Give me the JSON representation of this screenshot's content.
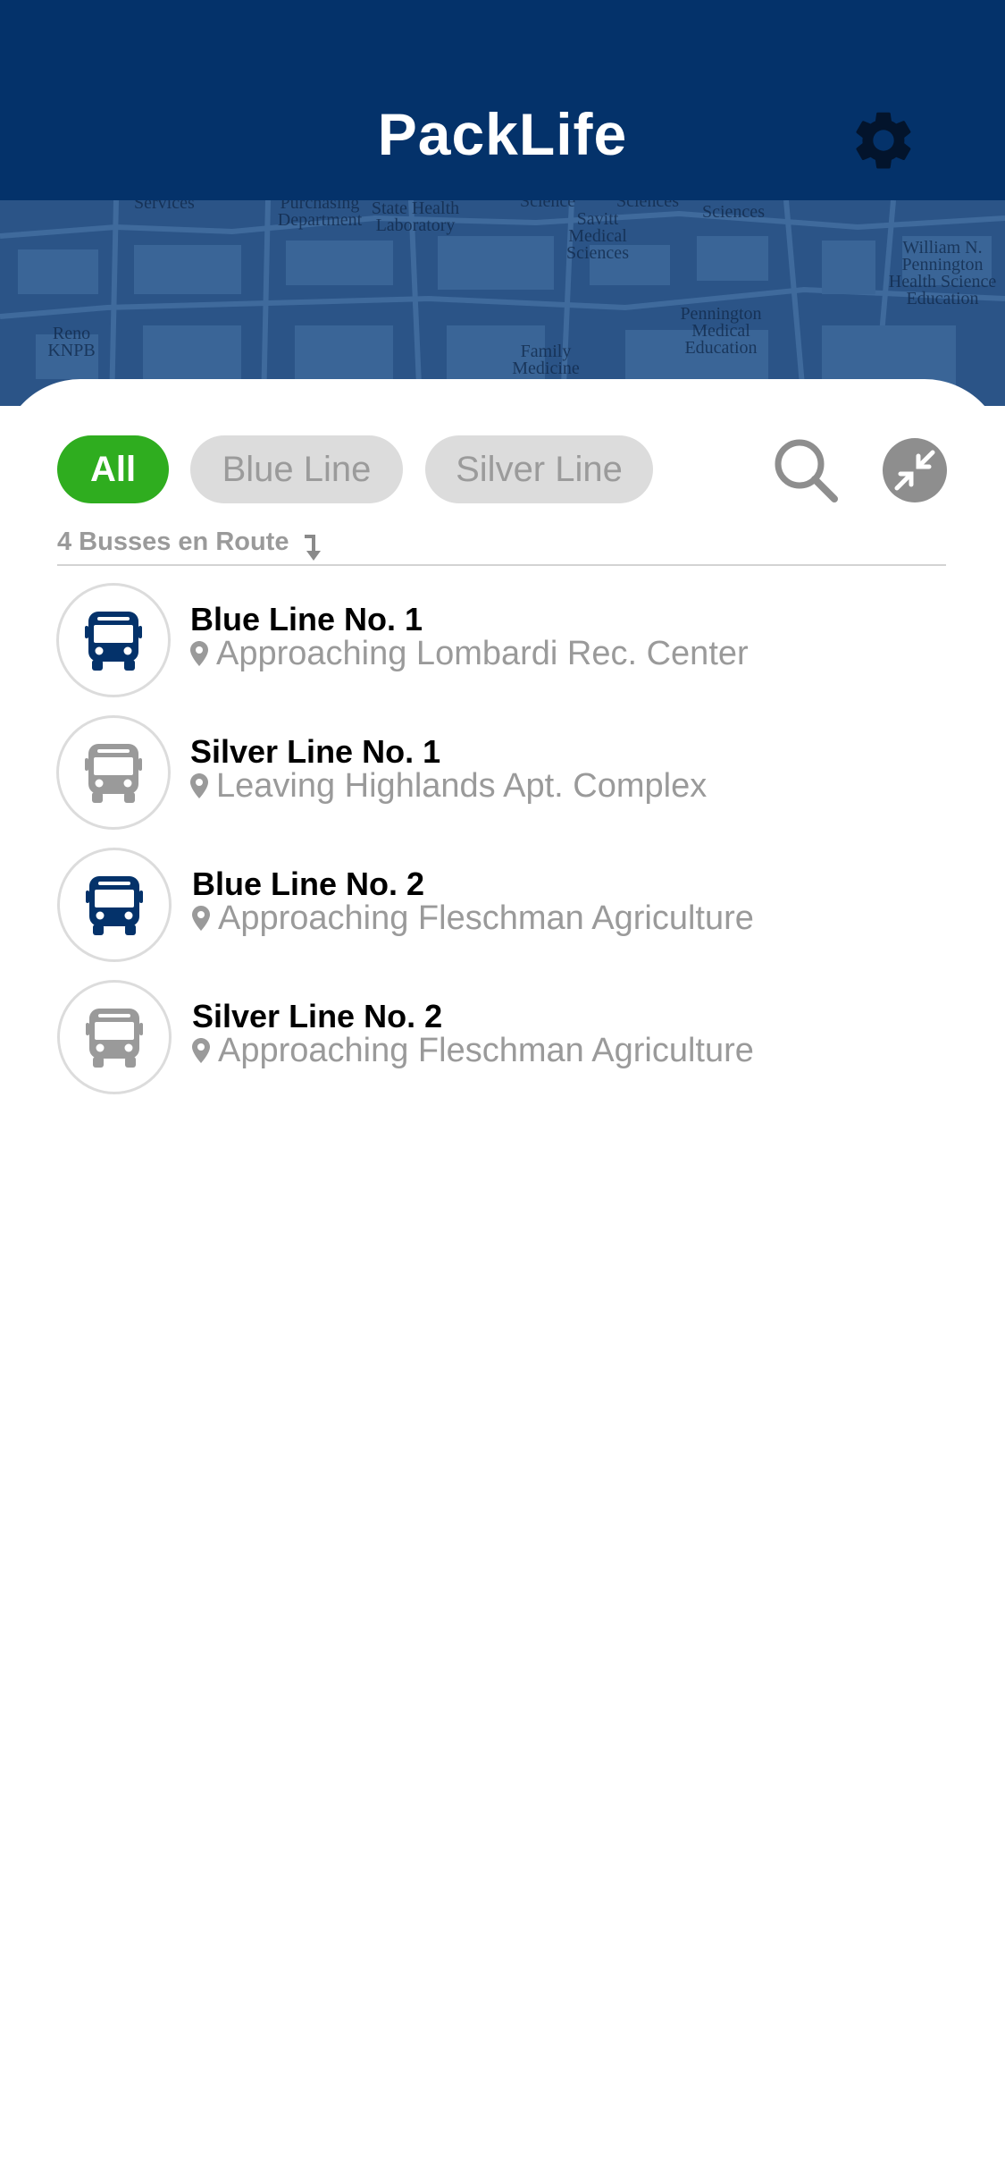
{
  "header": {
    "title": "PackLife",
    "settings_icon": "gear-icon"
  },
  "map": {
    "labels": [
      "Services",
      "Purchasing Department",
      "State Health Laboratory",
      "Science",
      "Savitt Medical Sciences",
      "Sciences",
      "Sciences",
      "William N. Pennington Health Science Education",
      "Pennington Medical Education",
      "Family Medicine",
      "Reno KNPB"
    ]
  },
  "filters": {
    "chips": [
      {
        "label": "All",
        "active": true
      },
      {
        "label": "Blue Line",
        "active": false
      },
      {
        "label": "Silver Line",
        "active": false
      }
    ],
    "search_icon": "search-icon",
    "collapse_icon": "collapse-icon"
  },
  "summary": {
    "count_label": "4 Busses en Route",
    "sort_icon": "sort-down-arrow-icon"
  },
  "colors": {
    "header": "#04326a",
    "active_chip": "#2fad1f",
    "blue_line": "#04326a",
    "silver_line": "#9a9a9a"
  },
  "buses": [
    {
      "name": "Blue Line No. 1",
      "status": "Approaching Lombardi Rec. Center",
      "line": "blue"
    },
    {
      "name": "Silver Line No. 1",
      "status": "Leaving Highlands Apt. Complex",
      "line": "silver"
    },
    {
      "name": "Blue Line No. 2",
      "status": "Approaching Fleschman Agriculture",
      "line": "blue"
    },
    {
      "name": "Silver Line No. 2",
      "status": "Approaching Fleschman Agriculture",
      "line": "silver"
    }
  ]
}
